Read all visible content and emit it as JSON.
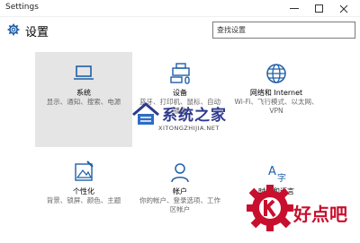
{
  "window": {
    "title": "Settings"
  },
  "header": {
    "title": "设置"
  },
  "search": {
    "value": "查找设置"
  },
  "tiles": [
    {
      "label": "系统",
      "desc": "显示、通知、搜索、电源"
    },
    {
      "label": "设备",
      "desc": "蓝牙、打印机、鼠标、自动播放"
    },
    {
      "label": "网络和 Internet",
      "desc": "Wi-Fi、飞行模式、以太网、VPN"
    },
    {
      "label": "个性化",
      "desc": "背景、锁屏、颜色、主题"
    },
    {
      "label": "帐户",
      "desc": "你的帐户、登录选项、工作区帐户"
    },
    {
      "label": "时间和语言",
      "desc": ""
    }
  ],
  "watermark": {
    "text": "系统之家",
    "sub": "XITONGZHIJIA.NET"
  },
  "badge": {
    "text": "好点吧"
  },
  "colors": {
    "accent": "#1f5fa8",
    "selected_tile": "#e5e5e5",
    "badge_red": "#c8102e",
    "watermark_blue": "#2e3a8c"
  }
}
